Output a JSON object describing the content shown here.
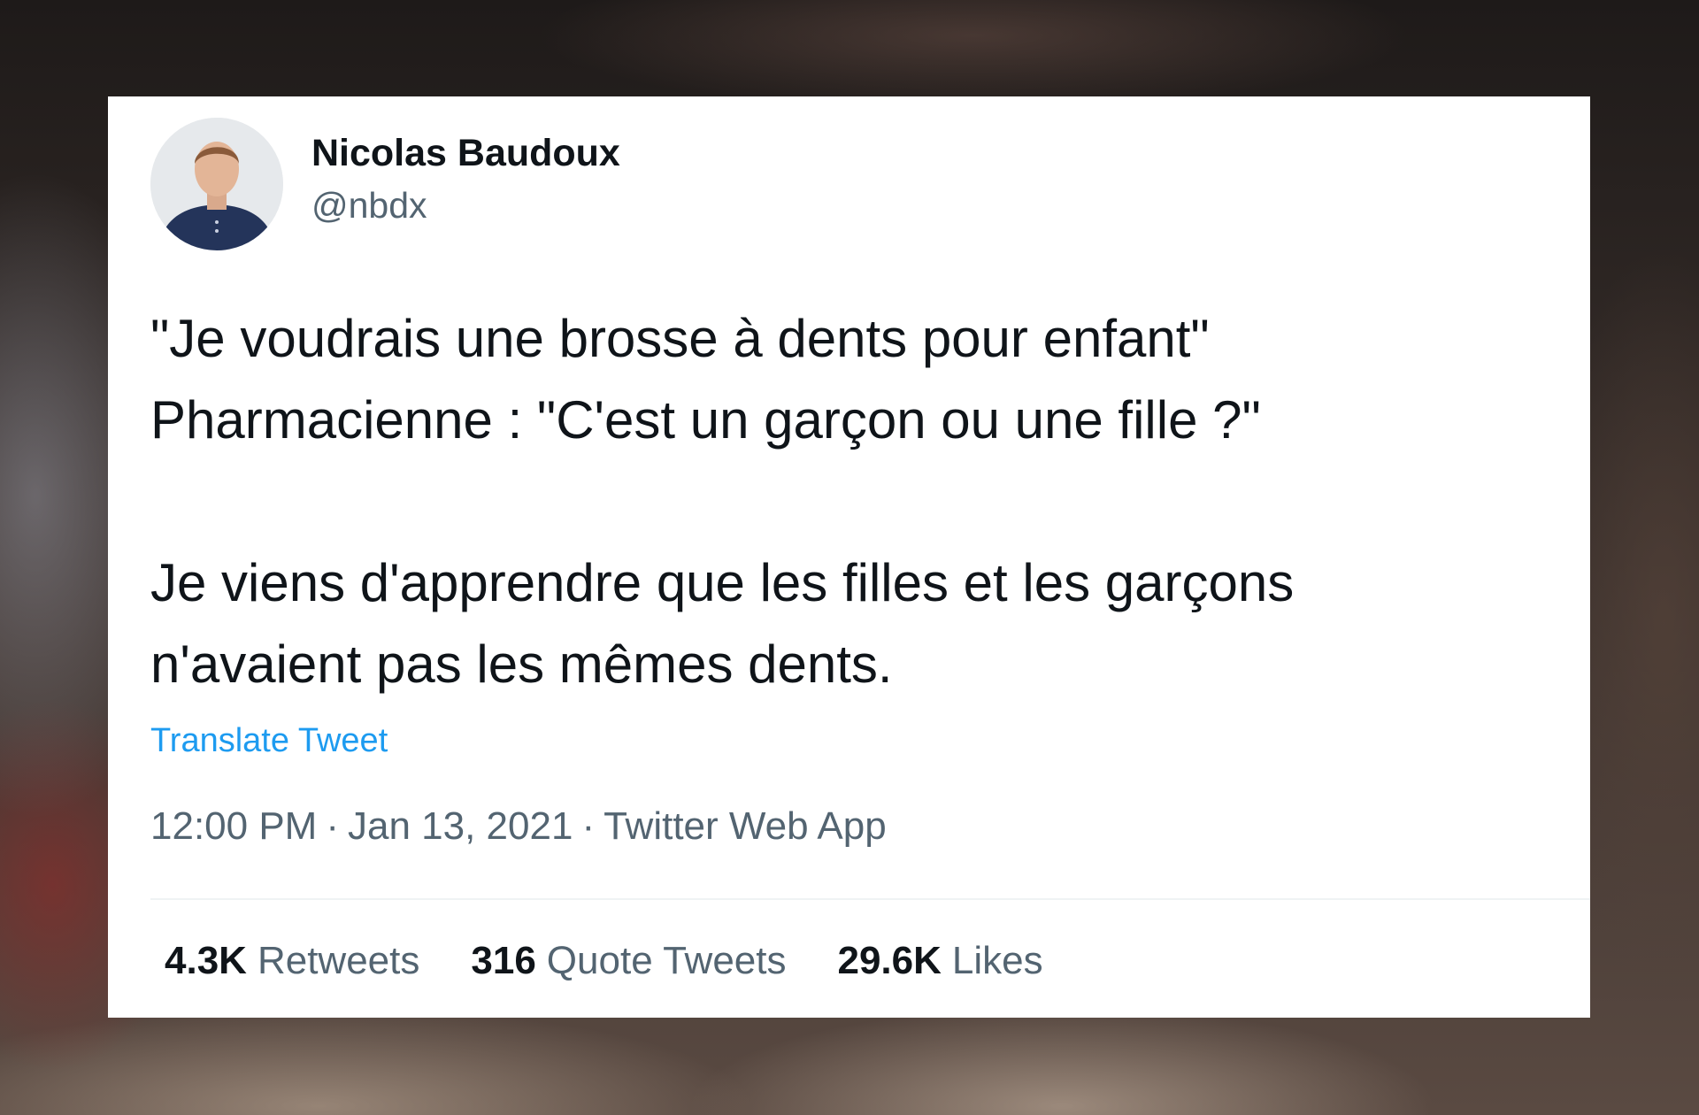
{
  "author": {
    "name": "Nicolas Baudoux",
    "handle": "@nbdx"
  },
  "tweet": {
    "lines": [
      "\"Je voudrais une brosse à dents pour enfant\"",
      "Pharmacienne : \"C'est un garçon ou une fille ?\"",
      "Je viens d'apprendre que les filles et les garçons",
      "n'avaient pas les mêmes dents."
    ],
    "translate_label": "Translate Tweet",
    "time": "12:00 PM",
    "date": "Jan 13, 2021",
    "source": "Twitter Web App",
    "separator": "·"
  },
  "stats": {
    "retweets": {
      "count": "4.3K",
      "label": "Retweets"
    },
    "quote_tweets": {
      "count": "316",
      "label": "Quote Tweets"
    },
    "likes": {
      "count": "29.6K",
      "label": "Likes"
    }
  },
  "colors": {
    "link": "#1d9bf0",
    "text_primary": "#0f1419",
    "text_secondary": "#536471",
    "divider": "#eff3f4"
  },
  "icons": {
    "avatar": "profile-photo"
  }
}
